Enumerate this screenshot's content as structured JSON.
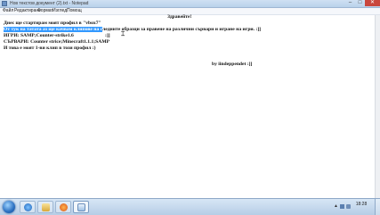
{
  "window": {
    "title": "Нов текстов документ (2).txt - Notepad",
    "controls": {
      "minimize": "–",
      "maximize": "□",
      "close": "✕"
    }
  },
  "menu": [
    "Файл",
    "Редактиране",
    "Формат",
    "Изглед",
    "Помощ"
  ],
  "document": {
    "heading": "Здравейте!",
    "line1": "Днес ще стартирам моят профил в \"vbox7\"",
    "line2_selected": "От тук на татата аз ще качвам клипове на с",
    "line2_rest": "ледните  образци за правене на различни сървари и игране на игри. :]]",
    "line3": "ИГРИ: SAMP;Counter-strike1.6",
    "line3_tail": ":]]",
    "line4": "СЪРВАРИ: Counter strice;Minecraft1.1.1;SAMP",
    "line5": "И това е моят 1-ви клип в този профил :)",
    "signature": "by iindeppendet :]]"
  },
  "taskbar": {
    "clock_time": "18:28",
    "clock_date": "",
    "buttons": [
      "ie-icon",
      "folder-icon",
      "media-icon",
      "notepad-icon"
    ]
  },
  "colors": {
    "selection": "#3399ff",
    "close_button": "#c9463d"
  }
}
